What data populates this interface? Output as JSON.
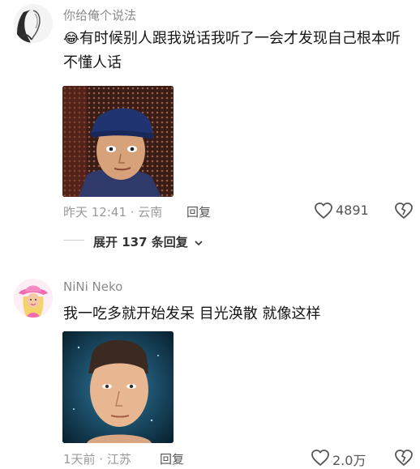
{
  "comments": [
    {
      "username": "你给俺个说法",
      "emoji": "😂",
      "text": "有时候别人跟我说话我听了一会才发现自己根本听不懂人话",
      "meta": "昨天 12:41 · 云南",
      "reply_label": "回复",
      "likes": "4891",
      "expand_label": "展开 137 条回复"
    },
    {
      "username": "NiNi Neko",
      "text": "我一吃多就开始发呆 目光涣散 就像这样",
      "meta": "1天前 · 江苏",
      "reply_label": "回复",
      "likes": "2.0万"
    }
  ]
}
